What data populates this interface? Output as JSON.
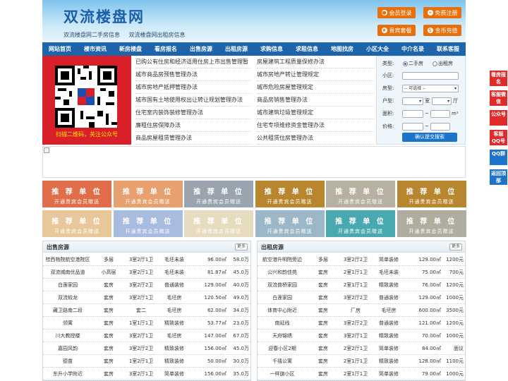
{
  "header": {
    "title": "双流楼盘网",
    "subtitle": [
      "双流楼盘网二手房信息",
      "双流楼盘网出租房信息"
    ],
    "buttons": [
      {
        "label": "会员登录",
        "icon": "user-icon"
      },
      {
        "label": "免费注册",
        "icon": "register-icon"
      },
      {
        "label": "贵宾套餐",
        "icon": "vip-icon"
      },
      {
        "label": "金币充值",
        "icon": "coin-icon"
      }
    ],
    "color": "#1b5fa8"
  },
  "nav": [
    "网站首页",
    "楼市资讯",
    "新房楼盘",
    "看房报名",
    "出售房源",
    "出租房源",
    "求购信息",
    "求租信息",
    "地图找房",
    "小区大全",
    "中介名录",
    "联系客服"
  ],
  "qr": {
    "caption": "扫描二维码，关注公众号"
  },
  "links": [
    "已购公有住房和经济适用住房上市出售管理暂",
    "房屋建筑工程质量保修办法",
    "城市商品房预售管理办法",
    "城市房地产转让管理规定",
    "城市房地产抵押管理办法",
    "城市危险房屋管理规定",
    "城市国有土地使用权出让转让规划管理办法",
    "商品房销售管理办法",
    "住宅室内装饰装修管理办法",
    "城市建筑垃圾管理规定",
    "廉租住房保障办法",
    "住宅专项维修资金管理办法",
    "商品房屋租赁管理办法",
    "公共租赁住房管理办法"
  ],
  "search": {
    "type_label": "类型:",
    "type_options": [
      "二手房",
      "出租房"
    ],
    "community_label": "小区:",
    "house_type_label": "房型:",
    "house_type_value": "-- 可选择 --",
    "layout_label": "户型:",
    "room_unit": "室",
    "hall_unit": "厅",
    "area_label": "面积:",
    "area_unit": "m²",
    "price_label": "价格:",
    "price_sep": "~",
    "submit": "确认提交搜索"
  },
  "ads": {
    "line1": "推 荐 单 位",
    "line2": "开通贵宾会员赠送",
    "colors": [
      "#e06e4a",
      "#e8a06e",
      "#9aa4b0",
      "#b8862e",
      "#b8b0a0",
      "#b8862e",
      "#e8c89a",
      "#a8bce0",
      "#e8dcc0",
      "#9cb8c8",
      "#4aa8b0",
      "#b0aca0"
    ]
  },
  "sale": {
    "title": "出售房源",
    "more": "更多",
    "rows": [
      [
        "桂西物院航空港院区",
        "多层",
        "3室2厅1卫",
        "毛坯未装",
        "96.00㎡",
        "58.0万"
      ],
      [
        "双流城南优品道",
        "小高层",
        "3室2厅1卫",
        "毛坯未装",
        "81.87㎡",
        "45.0万"
      ],
      [
        "白莲家园",
        "套房",
        "3室2厅2卫",
        "普通装修",
        "129.00㎡",
        "40.0万"
      ],
      [
        "双流蛟龙",
        "套房",
        "3室2厅1卫",
        "毛坯房",
        "120.50㎡",
        "49.0万"
      ],
      [
        "藏卫路南二段",
        "套房",
        "套二",
        "毛坯房",
        "62.00㎡",
        "34.0万"
      ],
      [
        "领寓",
        "套房",
        "1室1厅1卫",
        "精致装修",
        "53.77㎡",
        "23.0万"
      ],
      [
        "川大教授楼",
        "套房",
        "3室2厅1卫",
        "毛坯房",
        "147.00㎡",
        "67.0万"
      ],
      [
        "嘉园风韵",
        "套房",
        "3室2厅2卫",
        "精致装修",
        "156.00㎡",
        "45.0万"
      ],
      [
        "德苗",
        "套房",
        "1室2厅1卫",
        "精致装修",
        "50.00㎡",
        "30.0万"
      ],
      [
        "东升小学附近",
        "套房",
        "3室2厅1卫",
        "简单装修",
        "156.00㎡",
        "35.0万"
      ]
    ]
  },
  "rent": {
    "title": "出租房源",
    "more": "更多",
    "rows": [
      [
        "航空港升明院旁边",
        "多层",
        "3室2厅2卫",
        "简单装修",
        "129.00㎡",
        "1200元"
      ],
      [
        "公兴和韵佳苑",
        "套房",
        "2室1厅1卫",
        "毛坯未装",
        "75.00㎡",
        "700元"
      ],
      [
        "双流普桥家园",
        "套房",
        "2室1厅1卫",
        "精致装修",
        "76.00㎡",
        "1200元"
      ],
      [
        "白莲家园",
        "套房",
        "3室2厅2卫",
        "普通装修",
        "129.00㎡",
        "1000元"
      ],
      [
        "体育中心附近",
        "套房",
        "厂房",
        "毛坯房",
        "600.00㎡",
        "3500元"
      ],
      [
        "南延线",
        "套房",
        "3室2厅2卫",
        "普通装修",
        "121.00㎡",
        "1200元"
      ],
      [
        "天府锦绣",
        "套房",
        "3室2厅1卫",
        "精致装修",
        "70.00㎡",
        "1000元"
      ],
      [
        "迎春小区2期",
        "套房",
        "2室2厅1卫",
        "简单装修",
        "84.00㎡",
        "面议"
      ],
      [
        "千禧公寓",
        "套房",
        "2室1厅1卫",
        "精致装修",
        "128.00㎡",
        "1100元"
      ],
      [
        "一样旗小区",
        "套房",
        "2室1厅1卫",
        "简单装修",
        "79.00㎡",
        "1000元"
      ]
    ]
  },
  "side": [
    "看房报名",
    "客服微信",
    "公众号",
    "客服QQ号",
    "QQ群",
    "返回顶部"
  ]
}
